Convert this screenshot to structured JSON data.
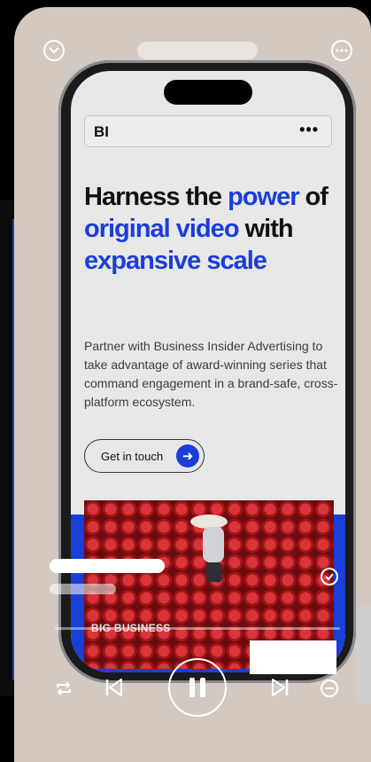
{
  "overlay": {
    "progress_fraction": 0.0
  },
  "site": {
    "logo": "BI",
    "menu": "•••",
    "headline_parts": [
      {
        "text": "Harness the ",
        "accent": false
      },
      {
        "text": "power",
        "accent": true
      },
      {
        "text": " of ",
        "accent": false
      },
      {
        "text": "original video",
        "accent": true
      },
      {
        "text": " with ",
        "accent": false
      },
      {
        "text": "expansive scale",
        "accent": true
      }
    ],
    "subcopy": "Partner with Business Insider Advertising to take advantage of award-winning series that command engagement in a brand-safe, cross-platform ecosystem.",
    "cta_label": "Get in touch",
    "cta_arrow": "➜",
    "hero_label": "BIG BUSINESS"
  },
  "icons": {
    "top_left": "chevron-down-icon",
    "top_right": "more-icon",
    "repeat": "repeat-icon",
    "prev": "previous-icon",
    "pause": "pause-icon",
    "next": "next-icon",
    "remove": "remove-icon",
    "check": "check-icon"
  },
  "colors": {
    "accent": "#1a3ed8",
    "card_bg": "#d3c9c1"
  }
}
